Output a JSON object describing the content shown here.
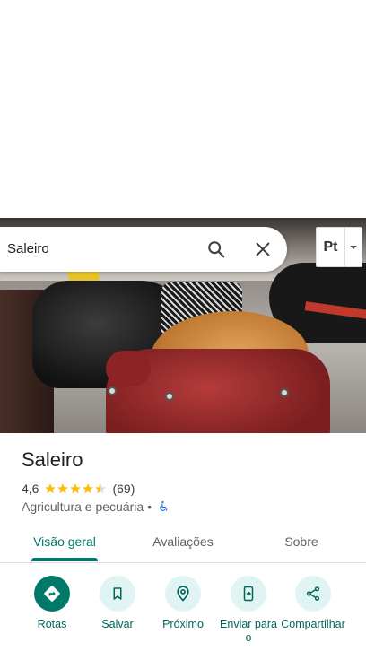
{
  "search": {
    "query": "Saleiro"
  },
  "language": {
    "code": "Pt"
  },
  "place": {
    "title": "Saleiro",
    "rating": "4,6",
    "stars": 4.5,
    "reviews_count": "(69)",
    "category": "Agricultura e pecuária",
    "separator": "•"
  },
  "tabs": [
    {
      "label": "Visão geral",
      "active": true
    },
    {
      "label": "Avaliações",
      "active": false
    },
    {
      "label": "Sobre",
      "active": false
    }
  ],
  "actions": [
    {
      "label": "Rotas",
      "icon": "directions-icon"
    },
    {
      "label": "Salvar",
      "icon": "bookmark-icon"
    },
    {
      "label": "Próximo",
      "icon": "nearby-icon"
    },
    {
      "label": "Enviar para o",
      "icon": "send-to-phone-icon"
    },
    {
      "label": "Compartilhar",
      "icon": "share-icon"
    }
  ],
  "colors": {
    "accent": "#00796b",
    "star": "#fbbc04",
    "action_bg": "#e0f5f3"
  }
}
